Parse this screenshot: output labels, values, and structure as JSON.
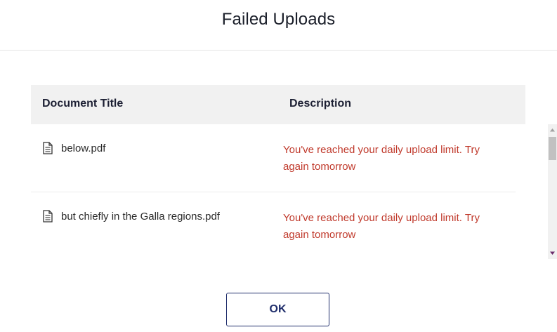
{
  "dialog": {
    "title": "Failed Uploads",
    "ok_label": "OK"
  },
  "table": {
    "columns": [
      "Document Title",
      "Description"
    ],
    "rows": [
      {
        "icon": "document-icon",
        "title": "below.pdf",
        "description": "You've reached your daily upload limit. Try again tomorrow"
      },
      {
        "icon": "document-icon",
        "title": "but chiefly in the Galla regions.pdf",
        "description": "You've reached your daily upload limit. Try again tomorrow"
      }
    ]
  },
  "colors": {
    "error_text": "#c0392b",
    "header_bg": "#f1f1f1",
    "button_border": "#1f2d6b"
  }
}
